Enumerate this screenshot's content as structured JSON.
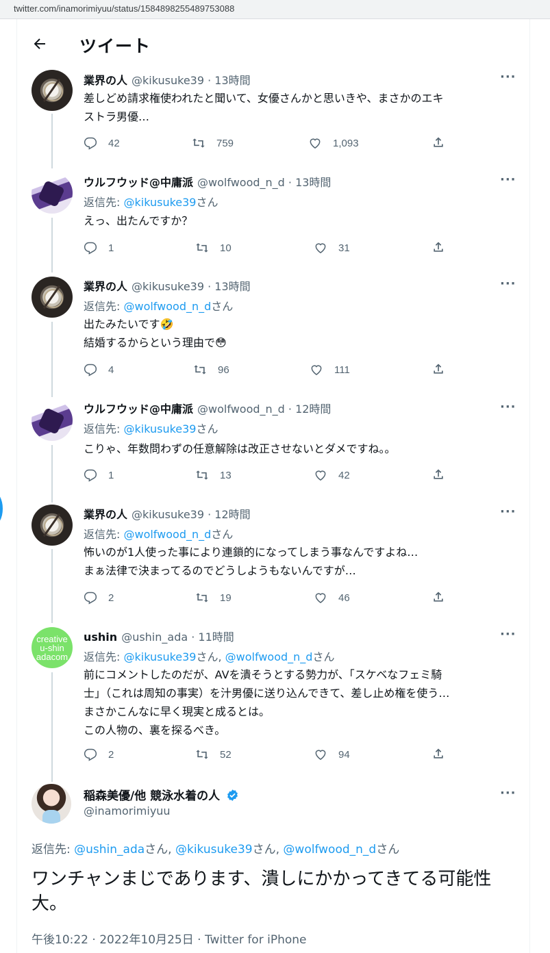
{
  "browser": {
    "url": "twitter.com/inamorimiyuu/status/1584898255489753088"
  },
  "header": {
    "title": "ツイート"
  },
  "more_label": "···",
  "tweets": [
    {
      "name": "業界の人",
      "meta": "@kikusuke39 · 13時間",
      "replying_prefix": "",
      "replying_to": [],
      "body": [
        "差しどめ請求権使われたと聞いて、女優さんかと思いきや、まさかのエキ",
        "ストラ男優…"
      ],
      "replies": "42",
      "retweets": "759",
      "likes": "1,093"
    },
    {
      "name": "ウルフウッド@中庸派",
      "meta": "@wolfwood_n_d · 13時間",
      "replying_prefix": "返信先: ",
      "replying_to": [
        "@kikusuke39"
      ],
      "body": [
        "えっ、出たんですか？"
      ],
      "replies": "1",
      "retweets": "10",
      "likes": "31"
    },
    {
      "name": "業界の人",
      "meta": "@kikusuke39 · 13時間",
      "replying_prefix": "返信先: ",
      "replying_to": [
        "@wolfwood_n_d"
      ],
      "body": [
        "出たみたいです🤣",
        "結婚するからという理由で😳"
      ],
      "replies": "4",
      "retweets": "96",
      "likes": "111"
    },
    {
      "name": "ウルフウッド@中庸派",
      "meta": "@wolfwood_n_d · 12時間",
      "replying_prefix": "返信先: ",
      "replying_to": [
        "@kikusuke39"
      ],
      "body": [
        "こりゃ、年数問わずの任意解除は改正させないとダメですね。。"
      ],
      "replies": "1",
      "retweets": "13",
      "likes": "42"
    },
    {
      "name": "業界の人",
      "meta": "@kikusuke39 · 12時間",
      "replying_prefix": "返信先: ",
      "replying_to": [
        "@wolfwood_n_d"
      ],
      "body": [
        "怖いのが1人使った事により連鎖的になってしまう事なんですよね…",
        "まぁ法律で決まってるのでどうしようもないんですが…"
      ],
      "replies": "2",
      "retweets": "19",
      "likes": "46"
    },
    {
      "name": "ushin",
      "meta": "@ushin_ada · 11時間",
      "replying_prefix": "返信先: ",
      "replying_to": [
        "@kikusuke39",
        "@wolfwood_n_d"
      ],
      "body": [
        "前にコメントしたのだが、AVを潰そうとする勢力が、「スケベなフェミ騎",
        "士」（これは周知の事実）を汁男優に送り込んできて、差し止め権を使う…",
        "まさかこんなに早く現実と成るとは。",
        "この人物の、裏を探るべき。"
      ],
      "replies": "2",
      "retweets": "52",
      "likes": "94"
    }
  ],
  "ushin_avatar": {
    "lines": [
      "creative",
      "u-shin",
      "adacom"
    ]
  },
  "san": "さん",
  "comma": ", ",
  "main": {
    "name": "稲森美優/他 競泳水着の人",
    "handle": "@inamorimiyuu",
    "replying_prefix": "返信先: ",
    "replying_to": [
      "@ushin_ada",
      "@kikusuke39",
      "@wolfwood_n_d"
    ],
    "text": "ワンチャンまじであります、潰しにかかってきてる可能性大。",
    "timestamp": "午後10:22 · 2022年10月25日 · Twitter for iPhone"
  },
  "colors": {
    "link": "#1d9bf0",
    "secondary": "#536471",
    "text": "#0f1419",
    "thread_line": "#cfd9de",
    "verified": "#1d9bf0"
  }
}
